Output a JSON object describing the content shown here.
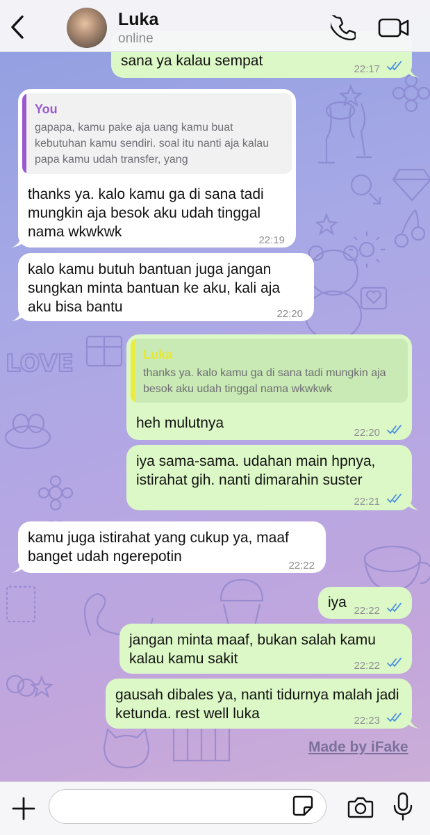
{
  "header": {
    "back_label": "",
    "contact_name": "Luka",
    "contact_status": "online"
  },
  "messages": [
    {
      "dir": "out",
      "text": "sana ya kalau sempat",
      "time": "22:17",
      "read": true
    },
    {
      "dir": "in",
      "quote": {
        "author": "You",
        "text": "gapapa, kamu pake aja uang kamu buat kebutuhan kamu sendiri. soal itu nanti aja kalau papa kamu udah transfer, yang"
      },
      "text": "thanks ya. kalo kamu ga di sana tadi mungkin aja besok aku udah tinggal nama wkwkwk",
      "time": "22:19"
    },
    {
      "dir": "in",
      "text": "kalo kamu butuh bantuan juga jangan sungkan minta bantuan ke aku, kali aja aku bisa bantu",
      "time": "22:20"
    },
    {
      "dir": "out",
      "quote": {
        "author": "Luka",
        "text": "thanks ya. kalo kamu ga di sana tadi mungkin aja besok aku udah tinggal nama wkwkwk"
      },
      "text": "heh mulutnya",
      "time": "22:20",
      "read": true
    },
    {
      "dir": "out",
      "text": "iya sama-sama. udahan main hpnya, istirahat gih. nanti dimarahin suster",
      "time": "22:21",
      "read": true
    },
    {
      "dir": "in",
      "text": "kamu juga istirahat yang cukup ya, maaf banget udah ngerepotin",
      "time": "22:22"
    },
    {
      "dir": "out",
      "text": "iya",
      "time": "22:22",
      "read": true
    },
    {
      "dir": "out",
      "text": "jangan minta maaf, bukan salah kamu kalau kamu sakit",
      "time": "22:22",
      "read": true
    },
    {
      "dir": "out",
      "text": "gausah dibales ya, nanti tidurnya malah jadi ketunda. rest well luka",
      "time": "22:23",
      "read": true
    }
  ],
  "watermark": "Made by iFake",
  "composer": {
    "placeholder": ""
  },
  "colors": {
    "incoming": "#ffffff",
    "outgoing": "#dcf8c6",
    "read_tick": "#4a8fe0",
    "quote_you": "#9b59d0",
    "quote_luka": "#ecec3a",
    "accent": "#1c1c1e"
  },
  "icons": [
    "back-chevron-icon",
    "phone-icon",
    "video-camera-icon",
    "plus-icon",
    "sticker-icon",
    "camera-icon",
    "microphone-icon",
    "double-check-icon"
  ]
}
